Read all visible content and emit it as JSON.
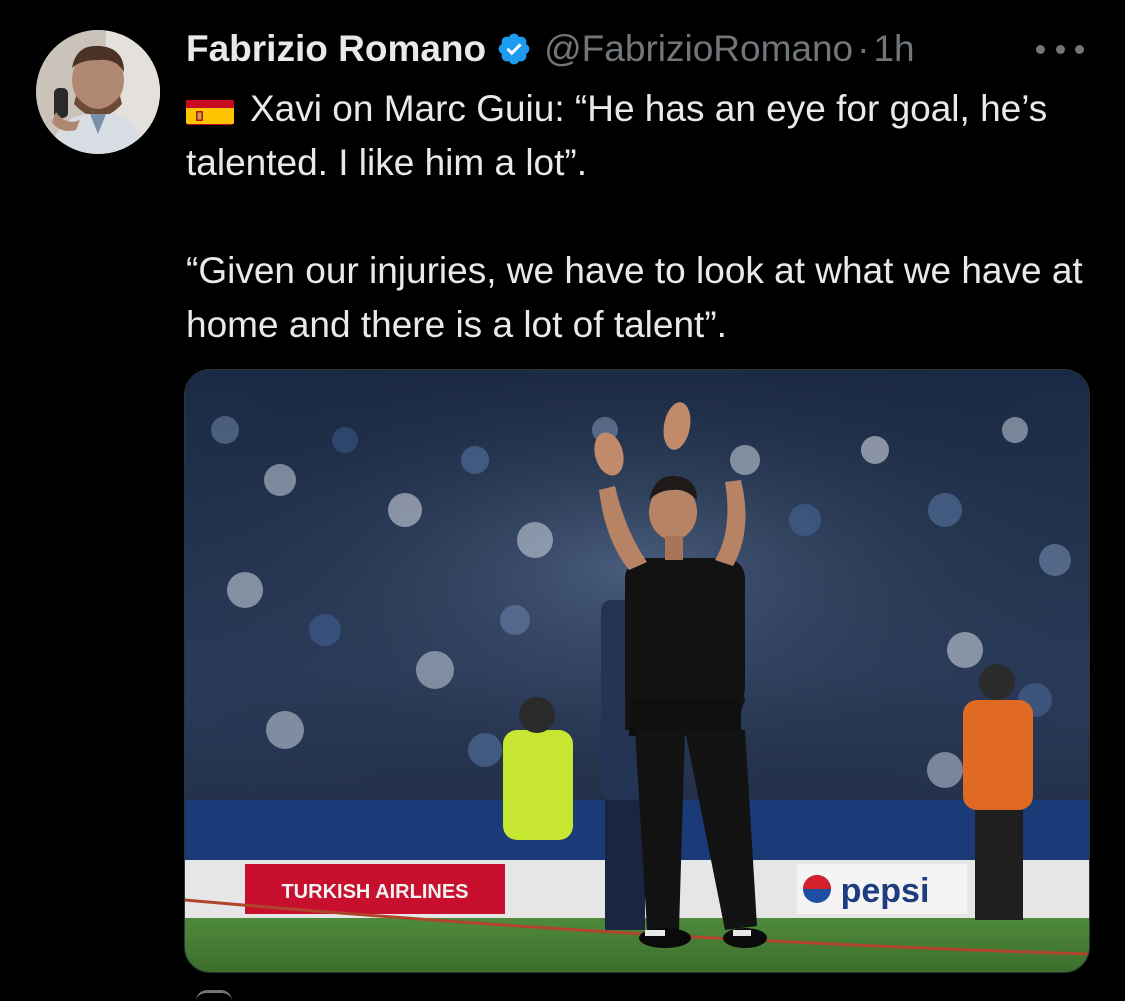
{
  "tweet": {
    "author": {
      "name": "Fabrizio Romano",
      "handle": "@FabrizioRomano",
      "verified": true
    },
    "separator": "·",
    "time": "1h",
    "flag_icon": "spain-flag-emoji",
    "text_line1": "Xavi on Marc Guiu: “He has an eye for goal, he’s talented. I like him a lot”.",
    "text_line2": "“Given our injuries, we have to look at what we have at home and there is a lot of talent”.",
    "media": {
      "type": "photo",
      "ad_boards": [
        "TURKISH AIRLINES",
        "pepsi"
      ]
    }
  },
  "colors": {
    "background": "#000000",
    "text_primary": "#e7e9ea",
    "text_secondary": "#71767b",
    "verified_badge": "#1d9bf0"
  },
  "icons": {
    "verified": "verified-badge-icon",
    "more": "more-options-icon"
  }
}
